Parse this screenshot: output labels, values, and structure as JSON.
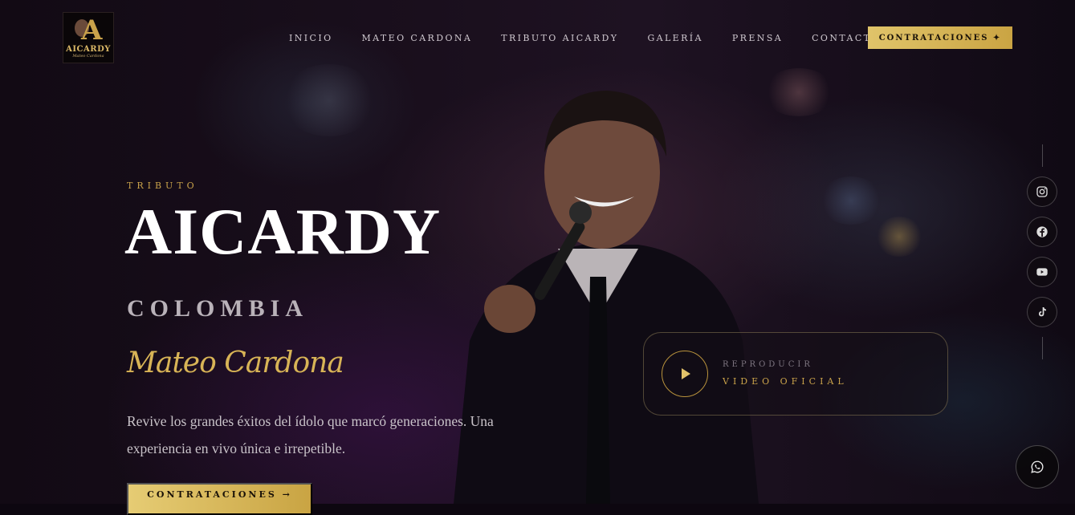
{
  "logo": {
    "title": "AICARDY",
    "subtitle": "Mateo Cardona",
    "letter": "A"
  },
  "nav": {
    "items": [
      {
        "label": "INICIO"
      },
      {
        "label": "MATEO CARDONA"
      },
      {
        "label": "TRIBUTO AICARDY"
      },
      {
        "label": "GALERÍA"
      },
      {
        "label": "PRENSA"
      },
      {
        "label": "CONTACTO"
      }
    ],
    "cta_label": "CONTRATACIONES ✦"
  },
  "hero": {
    "eyebrow": "TRIBUTO",
    "title": "AICARDY",
    "subtitle": "COLOMBIA",
    "script_name": "Mateo Cardona",
    "description": "Revive los grandes éxitos del ídolo que marcó generaciones. Una experiencia en vivo única e irrepetible.",
    "cta_label": "CONTRATACIONES →"
  },
  "video": {
    "kicker": "REPRODUCIR",
    "title": "VIDEO OFICIAL"
  },
  "social": [
    "instagram-icon",
    "facebook-icon",
    "youtube-icon",
    "tiktok-icon"
  ],
  "whatsapp": "whatsapp-icon",
  "colors": {
    "gold": "#c9a24a",
    "gold_light": "#e0c46a",
    "background": "#0d0710"
  }
}
